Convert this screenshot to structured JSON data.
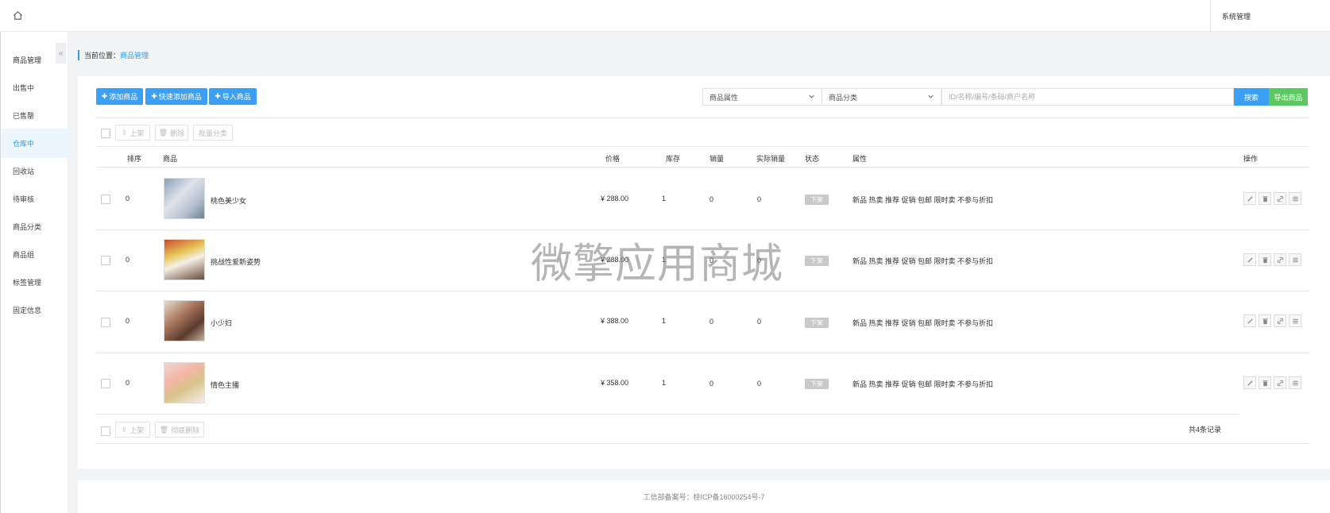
{
  "topbar": {
    "system_label": "系统管理"
  },
  "sidebar": {
    "header": "商品管理",
    "collapse_glyph": "«",
    "items": [
      {
        "label": "出售中",
        "active": false
      },
      {
        "label": "已售罄",
        "active": false
      },
      {
        "label": "仓库中",
        "active": true
      },
      {
        "label": "回收站",
        "active": false
      },
      {
        "label": "待审核",
        "active": false
      },
      {
        "label": "商品分类",
        "active": false
      },
      {
        "label": "商品组",
        "active": false
      },
      {
        "label": "标签管理",
        "active": false
      },
      {
        "label": "固定信息",
        "active": false
      }
    ]
  },
  "breadcrumb": {
    "prefix": "当前位置：",
    "current": "商品管理"
  },
  "toolbar": {
    "add_product": "添加商品",
    "quick_add": "快速添加商品",
    "import": "导入商品",
    "attr_select": "商品属性",
    "category_select": "商品分类",
    "search_placeholder": "ID/名称/编号/条码/商户名称",
    "search_button": "搜索",
    "export_button": "导出商品"
  },
  "bulk_top": {
    "shelf": "上架",
    "delete": "删除",
    "batch_category": "批量分类"
  },
  "columns": {
    "sort": "排序",
    "product": "商品",
    "price": "价格",
    "stock": "库存",
    "sales": "销量",
    "real_sales": "实际销量",
    "status": "状态",
    "attrs": "属性",
    "actions": "操作"
  },
  "rows": [
    {
      "sort": "0",
      "name": "桃色美少女",
      "price": "¥ 288.00",
      "stock": "1",
      "sales": "0",
      "real_sales": "0",
      "status": "下架",
      "attrs": "新品 热卖 推荐 促销 包邮 限时卖 不参与折扣"
    },
    {
      "sort": "0",
      "name": "挑战性爱新姿势",
      "price": "¥ 288.00",
      "stock": "1",
      "sales": "0",
      "real_sales": "0",
      "status": "下架",
      "attrs": "新品 热卖 推荐 促销 包邮 限时卖 不参与折扣"
    },
    {
      "sort": "0",
      "name": "小少妇",
      "price": "¥ 388.00",
      "stock": "1",
      "sales": "0",
      "real_sales": "0",
      "status": "下架",
      "attrs": "新品 热卖 推荐 促销 包邮 限时卖 不参与折扣"
    },
    {
      "sort": "0",
      "name": "情色主播",
      "price": "¥ 358.00",
      "stock": "1",
      "sales": "0",
      "real_sales": "0",
      "status": "下架",
      "attrs": "新品 热卖 推荐 促销 包邮 限时卖 不参与折扣"
    }
  ],
  "bulk_bottom": {
    "shelf": "上架",
    "delete_forever": "彻底删除"
  },
  "total_records": "共4条记录",
  "footer": {
    "icp": "工信部备案号：桂ICP备16000254号-7"
  },
  "watermark": "微擎应用商城",
  "colors": {
    "primary": "#3b9ff3",
    "success": "#5bc95f",
    "badge_off": "#c9c9c9"
  }
}
